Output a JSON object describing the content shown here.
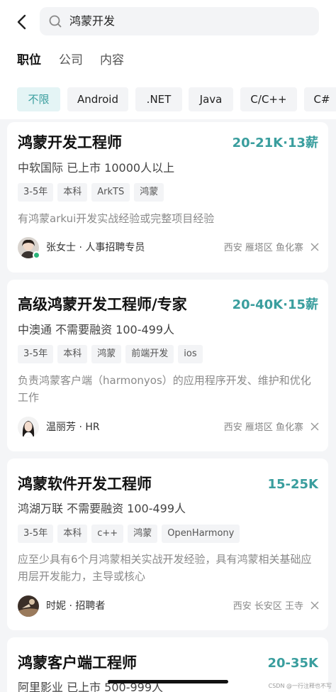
{
  "search": {
    "query": "鸿蒙开发"
  },
  "tabs": [
    {
      "label": "职位",
      "active": true
    },
    {
      "label": "公司"
    },
    {
      "label": "内容"
    }
  ],
  "filters": [
    "不限",
    "Android",
    ".NET",
    "Java",
    "C/C++",
    "C#"
  ],
  "jobs": [
    {
      "title": "鸿蒙开发工程师",
      "salary": "20-21K·13薪",
      "company": "中软国际 已上市 10000人以上",
      "tags": [
        "3-5年",
        "本科",
        "ArkTS",
        "鸿蒙"
      ],
      "desc": "有鸿蒙arkui开发实战经验或完整项目经验",
      "recruiter": "张女士 · 人事招聘专员",
      "location": "西安  雁塔区  鱼化寨"
    },
    {
      "title": "高级鸿蒙开发工程师/专家",
      "salary": "20-40K·15薪",
      "company": "中澳通 不需要融资 100-499人",
      "tags": [
        "3-5年",
        "本科",
        "鸿蒙",
        "前端开发",
        "ios"
      ],
      "desc": "负责鸿蒙客户端（harmonyos）的应用程序开发、维护和优化工作",
      "recruiter": "温丽芳 · HR",
      "location": "西安  雁塔区  鱼化寨"
    },
    {
      "title": "鸿蒙软件开发工程师",
      "salary": "15-25K",
      "company": "鸿湖万联 不需要融资 100-499人",
      "tags": [
        "3-5年",
        "本科",
        "c++",
        "鸿蒙",
        "OpenHarmony"
      ],
      "desc": "应至少具有6个月鸿蒙相关实战开发经验，具有鸿蒙相关基础应用层开发能力，主导或核心",
      "recruiter": "时妮 · 招聘者",
      "location": "西安  长安区  王寺"
    },
    {
      "title": "鸿蒙客户端工程师",
      "salary": "20-35K",
      "company": "阿里影业 已上市 500-999人"
    }
  ],
  "watermark": "CSDN @一行注释也不写",
  "colors": {
    "accent": "#3a9e9e",
    "chip_active_bg": "#e4f4f5",
    "online": "#2bb47a"
  }
}
